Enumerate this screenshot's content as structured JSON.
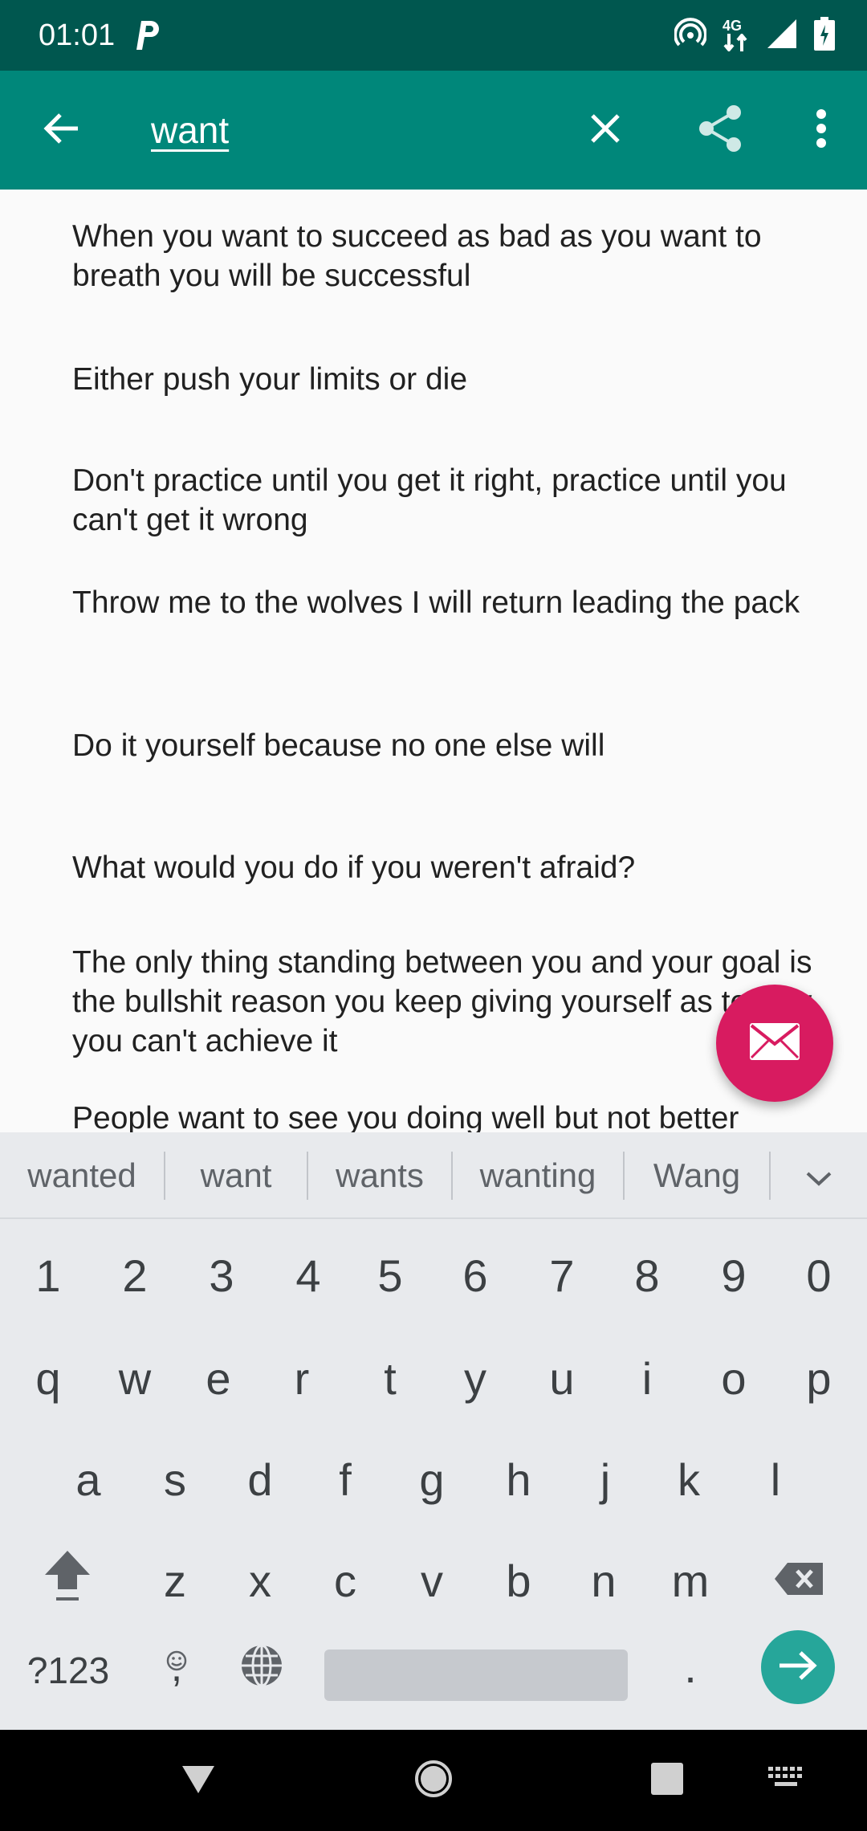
{
  "status_bar": {
    "time": "01:01",
    "network": "4G"
  },
  "app_bar": {
    "search_value": "want",
    "icons": [
      "arrow-back-icon",
      "close-icon",
      "share-icon",
      "more-vert-icon"
    ],
    "color": "#00877a"
  },
  "quotes": [
    "When you want to succeed as bad as you want to breath you will be successful",
    "Either push your limits or die",
    "Don't practice until you get it right, practice until you can't get it wrong",
    "Throw me to the wolves I will return leading the pack",
    "Do it yourself because no one else will",
    "What would you do if you weren't afraid?",
    "The only thing standing between you and your goal is the bullshit reason you keep giving yourself as to why you can't achieve it",
    "People want to see you doing well but not better"
  ],
  "fab": {
    "icon": "mail-icon",
    "color": "#d81b60"
  },
  "keyboard": {
    "suggestions": [
      "wanted",
      "want",
      "wants",
      "wanting",
      "Wang"
    ],
    "row_numbers": [
      "1",
      "2",
      "3",
      "4",
      "5",
      "6",
      "7",
      "8",
      "9",
      "0"
    ],
    "row_q": [
      "q",
      "w",
      "e",
      "r",
      "t",
      "y",
      "u",
      "i",
      "o",
      "p"
    ],
    "row_a": [
      "a",
      "s",
      "d",
      "f",
      "g",
      "h",
      "j",
      "k",
      "l"
    ],
    "row_z": [
      "z",
      "x",
      "c",
      "v",
      "b",
      "n",
      "m"
    ],
    "symbols_label": "?123",
    "comma_label": ",",
    "period_label": "."
  }
}
